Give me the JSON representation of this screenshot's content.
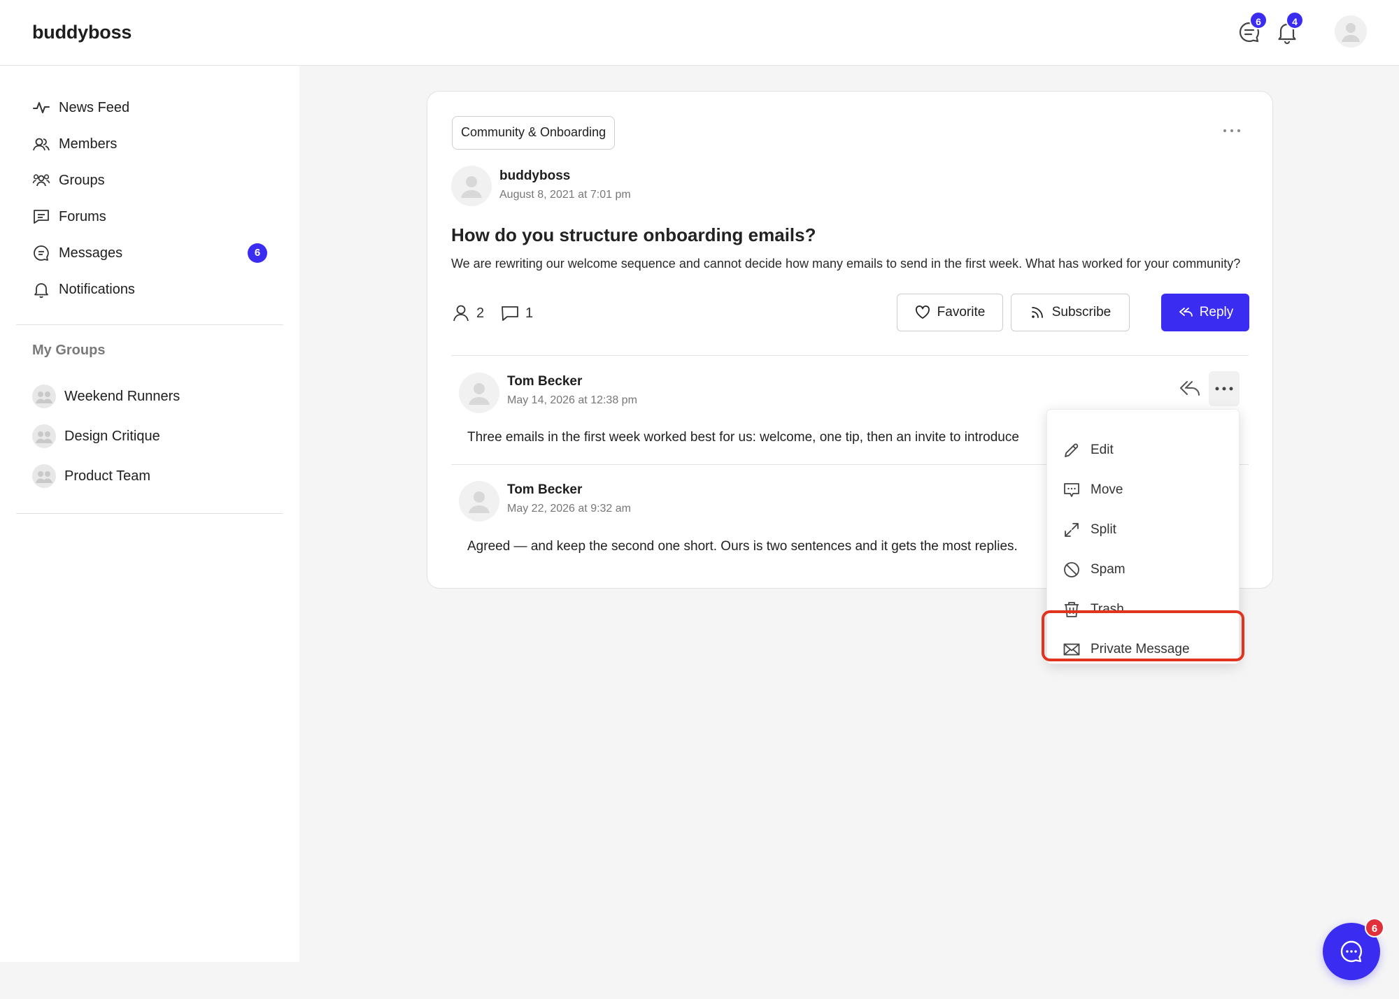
{
  "header": {
    "logo": "buddyboss",
    "messages_badge": "6",
    "notifications_badge": "4"
  },
  "sidebar": {
    "items": [
      {
        "label": "News Feed",
        "icon": "activity-icon"
      },
      {
        "label": "Members",
        "icon": "members-icon"
      },
      {
        "label": "Groups",
        "icon": "groups-icon"
      },
      {
        "label": "Forums",
        "icon": "forums-icon"
      },
      {
        "label": "Messages",
        "icon": "messages-icon",
        "badge": "6"
      },
      {
        "label": "Notifications",
        "icon": "bell-icon"
      }
    ],
    "section_title": "My Groups",
    "groups": [
      {
        "label": "Weekend Runners"
      },
      {
        "label": "Design Critique"
      },
      {
        "label": "Product Team"
      }
    ]
  },
  "topic": {
    "tag": "Community & Onboarding",
    "author": "buddyboss",
    "date": "August 8, 2021 at 7:01 pm",
    "title": "How do you structure onboarding emails?",
    "body": "We are rewriting our welcome sequence and cannot decide how many emails to send in the first week. What has worked for your community?",
    "members_count": "2",
    "replies_count": "1",
    "favorite_label": "Favorite",
    "subscribe_label": "Subscribe",
    "reply_label": "Reply"
  },
  "replies": [
    {
      "author": "Tom Becker",
      "date": "May 14, 2026 at 12:38 pm",
      "text": "Three emails in the first week worked best for us: welcome, one tip, then an invite to introduce"
    },
    {
      "author": "Tom Becker",
      "date": "May 22, 2026 at 9:32 am",
      "text": "Agreed — and keep the second one short. Ours is two sentences and it gets the most replies."
    }
  ],
  "dropdown": {
    "items": [
      {
        "label": "Edit",
        "icon": "pencil-icon"
      },
      {
        "label": "Move",
        "icon": "move-icon"
      },
      {
        "label": "Split",
        "icon": "split-icon"
      },
      {
        "label": "Spam",
        "icon": "spam-icon"
      },
      {
        "label": "Trash",
        "icon": "trash-icon"
      },
      {
        "label": "Private Message",
        "icon": "envelope-icon"
      }
    ]
  },
  "chat_fab": {
    "badge": "6"
  },
  "colors": {
    "accent": "#3a2cf0",
    "highlight": "#e1341e",
    "fab_badge": "#e2303a"
  }
}
